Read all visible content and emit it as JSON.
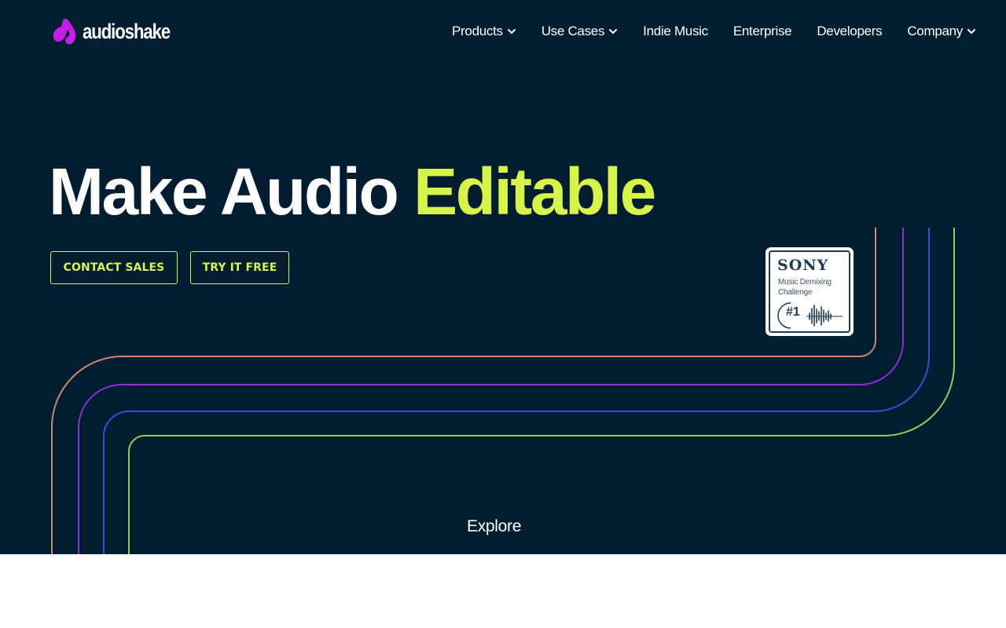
{
  "brand": {
    "name": "audioshake",
    "logo_color": "#c61ee8"
  },
  "nav": {
    "items": [
      {
        "label": "Products",
        "has_dropdown": true
      },
      {
        "label": "Use Cases",
        "has_dropdown": true
      },
      {
        "label": "Indie Music",
        "has_dropdown": false
      },
      {
        "label": "Enterprise",
        "has_dropdown": false
      },
      {
        "label": "Developers",
        "has_dropdown": false
      },
      {
        "label": "Company",
        "has_dropdown": true
      }
    ]
  },
  "hero": {
    "title_main": "Make Audio ",
    "title_accent": "Editable",
    "accent_color": "#d8f34a",
    "background_color": "#021c30",
    "buttons": {
      "contact": "CONTACT SALES",
      "try": "TRY IT FREE"
    },
    "line_colors": [
      "#c98a6e",
      "#8a2fd6",
      "#2e52d8",
      "#9ccc4e"
    ]
  },
  "badge": {
    "brand": "SONY",
    "line1": "Music Demixing",
    "line2": "Challenge",
    "rank": "#1"
  },
  "explore_label": "Explore"
}
